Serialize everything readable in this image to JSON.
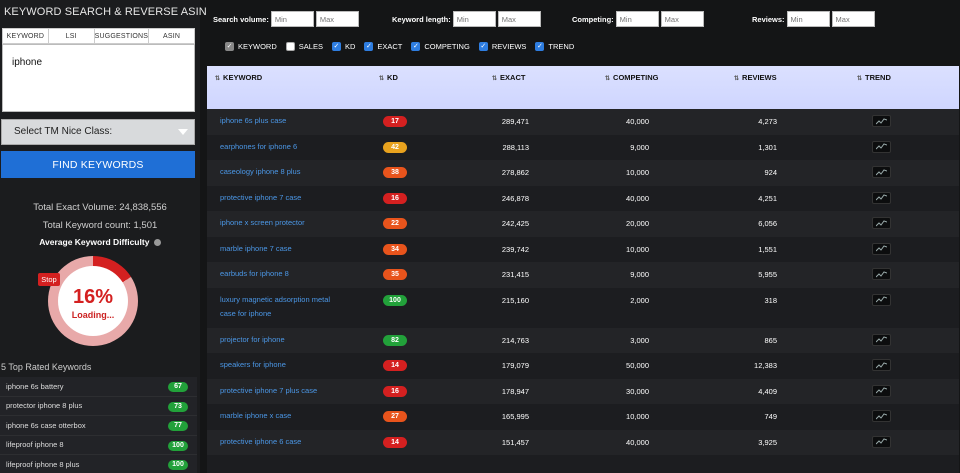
{
  "app": {
    "title": "KEYWORD SEARCH & REVERSE ASIN"
  },
  "mode_tabs": [
    "KEYWORD",
    "LSI",
    "SUGGESTIONS",
    "ASIN"
  ],
  "keyword_input": {
    "value": "iphone"
  },
  "class_select": {
    "label": "Select TM Nice Class:"
  },
  "find_button": {
    "label": "FIND KEYWORDS"
  },
  "stats": {
    "total_exact_volume": "Total Exact Volume: 24,838,556",
    "total_keyword_count": "Total Keyword count: 1,501",
    "avg_difficulty_label": "Average Keyword Difficulty"
  },
  "gauge": {
    "stop_label": "Stop",
    "percent_text": "16%",
    "percent": 16,
    "loading_text": "Loading..."
  },
  "top_rated": {
    "title": "5 Top Rated Keywords",
    "items": [
      {
        "keyword": "iphone 6s battery",
        "score": "67"
      },
      {
        "keyword": "protector iphone 8 plus",
        "score": "73"
      },
      {
        "keyword": "iphone 6s case otterbox",
        "score": "77"
      },
      {
        "keyword": "lifeproof iphone 8",
        "score": "100"
      },
      {
        "keyword": "lifeproof iphone 8 plus",
        "score": "100"
      }
    ]
  },
  "filters": [
    {
      "label": "Search volume:",
      "min_placeholder": "Min",
      "max_placeholder": "Max"
    },
    {
      "label": "Keyword length:",
      "min_placeholder": "Min",
      "max_placeholder": "Max"
    },
    {
      "label": "Competing:",
      "min_placeholder": "Min",
      "max_placeholder": "Max"
    },
    {
      "label": "Reviews:",
      "min_placeholder": "Min",
      "max_placeholder": "Max"
    }
  ],
  "columns_toggle": [
    {
      "label": "KEYWORD",
      "state": "grey"
    },
    {
      "label": "SALES",
      "state": "off"
    },
    {
      "label": "KD",
      "state": "on"
    },
    {
      "label": "EXACT",
      "state": "on"
    },
    {
      "label": "COMPETING",
      "state": "on"
    },
    {
      "label": "REVIEWS",
      "state": "on"
    },
    {
      "label": "TREND",
      "state": "on"
    }
  ],
  "table": {
    "headers": [
      "KEYWORD",
      "KD",
      "EXACT",
      "COMPETING",
      "REVIEWS",
      "TREND"
    ],
    "rows": [
      {
        "keyword": "iphone 6s plus case",
        "kd": "17",
        "exact": "289,471",
        "competing": "40,000",
        "reviews": "4,273"
      },
      {
        "keyword": "earphones for iphone 6",
        "kd": "42",
        "exact": "288,113",
        "competing": "9,000",
        "reviews": "1,301"
      },
      {
        "keyword": "caseology iphone 8 plus",
        "kd": "38",
        "exact": "278,862",
        "competing": "10,000",
        "reviews": "924"
      },
      {
        "keyword": "protective iphone 7 case",
        "kd": "16",
        "exact": "246,878",
        "competing": "40,000",
        "reviews": "4,251"
      },
      {
        "keyword": "iphone x screen protector",
        "kd": "22",
        "exact": "242,425",
        "competing": "20,000",
        "reviews": "6,056"
      },
      {
        "keyword": "marble iphone 7 case",
        "kd": "34",
        "exact": "239,742",
        "competing": "10,000",
        "reviews": "1,551"
      },
      {
        "keyword": "earbuds for iphone 8",
        "kd": "35",
        "exact": "231,415",
        "competing": "9,000",
        "reviews": "5,955"
      },
      {
        "keyword": "luxury magnetic adsorption metal case for iphone",
        "kd": "100",
        "exact": "215,160",
        "competing": "2,000",
        "reviews": "318"
      },
      {
        "keyword": "projector for iphone",
        "kd": "82",
        "exact": "214,763",
        "competing": "3,000",
        "reviews": "865"
      },
      {
        "keyword": "speakers for iphone",
        "kd": "14",
        "exact": "179,079",
        "competing": "50,000",
        "reviews": "12,383"
      },
      {
        "keyword": "protective iphone 7 plus case",
        "kd": "16",
        "exact": "178,947",
        "competing": "30,000",
        "reviews": "4,409"
      },
      {
        "keyword": "marble iphone x case",
        "kd": "27",
        "exact": "165,995",
        "competing": "10,000",
        "reviews": "749"
      },
      {
        "keyword": "protective iphone 6 case",
        "kd": "14",
        "exact": "151,457",
        "competing": "40,000",
        "reviews": "3,925"
      }
    ]
  },
  "colors": {
    "accent_blue": "#1f6fd6",
    "kd_red": "#d42020",
    "kd_orange_red": "#e8541c",
    "kd_orange": "#e8a21e",
    "kd_green": "#22a13a",
    "link_blue": "#4b97e6"
  }
}
